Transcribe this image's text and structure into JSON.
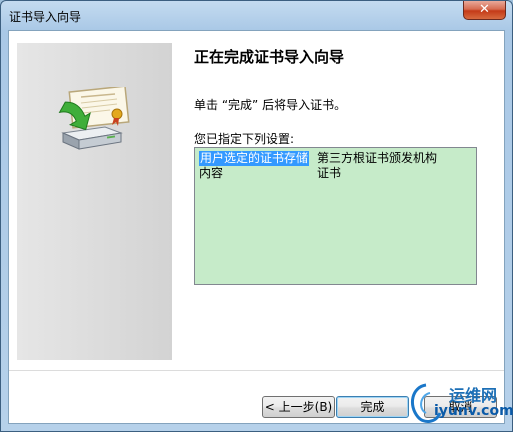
{
  "window": {
    "title": "证书导入向导",
    "close_label": "✕"
  },
  "wizard": {
    "heading": "正在完成证书导入向导",
    "description": "单击 “完成” 后将导入证书。",
    "settings_label": "您已指定下列设置:",
    "settings_rows": [
      {
        "setting": "用户选定的证书存储",
        "value": "第三方根证书颁发机构"
      },
      {
        "setting": "内容",
        "value": "证书"
      }
    ]
  },
  "buttons": {
    "back": "< 上一步(B)",
    "finish": "完成",
    "cancel": "取消"
  },
  "watermark": {
    "cn": "运维网",
    "en": "iyunv.com"
  },
  "colors": {
    "settings_bg": "#c6ebc9",
    "selection": "#3399ff",
    "close_button": "#c43b18"
  },
  "icons": [
    "certificate-icon",
    "install-arrow-icon",
    "drive-icon",
    "close-icon"
  ]
}
